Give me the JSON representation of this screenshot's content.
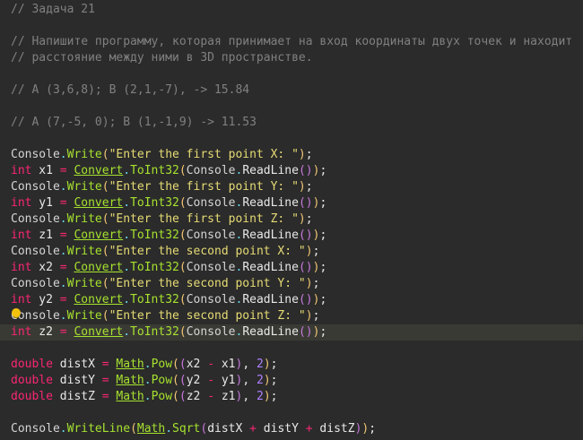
{
  "editor": {
    "current_line": 20,
    "lines": [
      [
        {
          "t": "// Задача 21",
          "k": "comment"
        }
      ],
      [],
      [
        {
          "t": "// Напишите программу, которая принимает на вход координаты двух точек и находит",
          "k": "comment"
        }
      ],
      [
        {
          "t": "// расстояние между ними в 3D пространстве.",
          "k": "comment"
        }
      ],
      [],
      [
        {
          "t": "// A (3,6,8); B (2,1,-7), -> 15.84",
          "k": "comment"
        }
      ],
      [],
      [
        {
          "t": "// A (7,-5, 0); B (1,-1,9) -> 11.53",
          "k": "comment"
        }
      ],
      [],
      [
        {
          "t": "Console",
          "k": "type"
        },
        {
          "t": ".",
          "k": "dot"
        },
        {
          "t": "Write",
          "k": "method"
        },
        {
          "t": "(",
          "k": "p1"
        },
        {
          "t": "\"Enter the first point X: \"",
          "k": "string"
        },
        {
          "t": ")",
          "k": "p1"
        },
        {
          "t": ";",
          "k": "punct"
        }
      ],
      [
        {
          "t": "int",
          "k": "keyword"
        },
        {
          "t": " x1 ",
          "k": "ident"
        },
        {
          "t": "=",
          "k": "op"
        },
        {
          "t": " ",
          "k": "ident"
        },
        {
          "t": "Convert",
          "k": "class"
        },
        {
          "t": ".",
          "k": "dot"
        },
        {
          "t": "ToInt32",
          "k": "method"
        },
        {
          "t": "(",
          "k": "p1"
        },
        {
          "t": "Console",
          "k": "type"
        },
        {
          "t": ".",
          "k": "dot"
        },
        {
          "t": "ReadLine",
          "k": "ident"
        },
        {
          "t": "(",
          "k": "p2"
        },
        {
          "t": ")",
          "k": "p2"
        },
        {
          "t": ")",
          "k": "p1"
        },
        {
          "t": ";",
          "k": "punct"
        }
      ],
      [
        {
          "t": "Console",
          "k": "type"
        },
        {
          "t": ".",
          "k": "dot"
        },
        {
          "t": "Write",
          "k": "method"
        },
        {
          "t": "(",
          "k": "p1"
        },
        {
          "t": "\"Enter the first point Y: \"",
          "k": "string"
        },
        {
          "t": ")",
          "k": "p1"
        },
        {
          "t": ";",
          "k": "punct"
        }
      ],
      [
        {
          "t": "int",
          "k": "keyword"
        },
        {
          "t": " y1 ",
          "k": "ident"
        },
        {
          "t": "=",
          "k": "op"
        },
        {
          "t": " ",
          "k": "ident"
        },
        {
          "t": "Convert",
          "k": "class"
        },
        {
          "t": ".",
          "k": "dot"
        },
        {
          "t": "ToInt32",
          "k": "method"
        },
        {
          "t": "(",
          "k": "p1"
        },
        {
          "t": "Console",
          "k": "type"
        },
        {
          "t": ".",
          "k": "dot"
        },
        {
          "t": "ReadLine",
          "k": "ident"
        },
        {
          "t": "(",
          "k": "p2"
        },
        {
          "t": ")",
          "k": "p2"
        },
        {
          "t": ")",
          "k": "p1"
        },
        {
          "t": ";",
          "k": "punct"
        }
      ],
      [
        {
          "t": "Console",
          "k": "type"
        },
        {
          "t": ".",
          "k": "dot"
        },
        {
          "t": "Write",
          "k": "method"
        },
        {
          "t": "(",
          "k": "p1"
        },
        {
          "t": "\"Enter the first point Z: \"",
          "k": "string"
        },
        {
          "t": ")",
          "k": "p1"
        },
        {
          "t": ";",
          "k": "punct"
        }
      ],
      [
        {
          "t": "int",
          "k": "keyword"
        },
        {
          "t": " z1 ",
          "k": "ident"
        },
        {
          "t": "=",
          "k": "op"
        },
        {
          "t": " ",
          "k": "ident"
        },
        {
          "t": "Convert",
          "k": "class"
        },
        {
          "t": ".",
          "k": "dot"
        },
        {
          "t": "ToInt32",
          "k": "method"
        },
        {
          "t": "(",
          "k": "p1"
        },
        {
          "t": "Console",
          "k": "type"
        },
        {
          "t": ".",
          "k": "dot"
        },
        {
          "t": "ReadLine",
          "k": "ident"
        },
        {
          "t": "(",
          "k": "p2"
        },
        {
          "t": ")",
          "k": "p2"
        },
        {
          "t": ")",
          "k": "p1"
        },
        {
          "t": ";",
          "k": "punct"
        }
      ],
      [
        {
          "t": "Console",
          "k": "type"
        },
        {
          "t": ".",
          "k": "dot"
        },
        {
          "t": "Write",
          "k": "method"
        },
        {
          "t": "(",
          "k": "p1"
        },
        {
          "t": "\"Enter the second point X: \"",
          "k": "string"
        },
        {
          "t": ")",
          "k": "p1"
        },
        {
          "t": ";",
          "k": "punct"
        }
      ],
      [
        {
          "t": "int",
          "k": "keyword"
        },
        {
          "t": " x2 ",
          "k": "ident"
        },
        {
          "t": "=",
          "k": "op"
        },
        {
          "t": " ",
          "k": "ident"
        },
        {
          "t": "Convert",
          "k": "class"
        },
        {
          "t": ".",
          "k": "dot"
        },
        {
          "t": "ToInt32",
          "k": "method"
        },
        {
          "t": "(",
          "k": "p1"
        },
        {
          "t": "Console",
          "k": "type"
        },
        {
          "t": ".",
          "k": "dot"
        },
        {
          "t": "ReadLine",
          "k": "ident"
        },
        {
          "t": "(",
          "k": "p2"
        },
        {
          "t": ")",
          "k": "p2"
        },
        {
          "t": ")",
          "k": "p1"
        },
        {
          "t": ";",
          "k": "punct"
        }
      ],
      [
        {
          "t": "Console",
          "k": "type"
        },
        {
          "t": ".",
          "k": "dot"
        },
        {
          "t": "Write",
          "k": "method"
        },
        {
          "t": "(",
          "k": "p1"
        },
        {
          "t": "\"Enter the second point Y: \"",
          "k": "string"
        },
        {
          "t": ")",
          "k": "p1"
        },
        {
          "t": ";",
          "k": "punct"
        }
      ],
      [
        {
          "t": "int",
          "k": "keyword"
        },
        {
          "t": " y2 ",
          "k": "ident"
        },
        {
          "t": "=",
          "k": "op"
        },
        {
          "t": " ",
          "k": "ident"
        },
        {
          "t": "Convert",
          "k": "class"
        },
        {
          "t": ".",
          "k": "dot"
        },
        {
          "t": "ToInt32",
          "k": "method"
        },
        {
          "t": "(",
          "k": "p1"
        },
        {
          "t": "Console",
          "k": "type"
        },
        {
          "t": ".",
          "k": "dot"
        },
        {
          "t": "ReadLine",
          "k": "ident"
        },
        {
          "t": "(",
          "k": "p2"
        },
        {
          "t": ")",
          "k": "p2"
        },
        {
          "t": ")",
          "k": "p1"
        },
        {
          "t": ";",
          "k": "punct"
        }
      ],
      [
        {
          "t": "Console",
          "k": "type"
        },
        {
          "t": ".",
          "k": "dot"
        },
        {
          "t": "Write",
          "k": "method"
        },
        {
          "t": "(",
          "k": "p1"
        },
        {
          "t": "\"Enter the second point Z: \"",
          "k": "string"
        },
        {
          "t": ")",
          "k": "p1"
        },
        {
          "t": ";",
          "k": "punct"
        }
      ],
      [
        {
          "t": "int",
          "k": "keyword"
        },
        {
          "t": " z2 ",
          "k": "ident"
        },
        {
          "t": "=",
          "k": "op"
        },
        {
          "t": " ",
          "k": "ident"
        },
        {
          "t": "Convert",
          "k": "class"
        },
        {
          "t": ".",
          "k": "dot"
        },
        {
          "t": "ToInt32",
          "k": "method"
        },
        {
          "t": "(",
          "k": "p1"
        },
        {
          "t": "Console",
          "k": "type"
        },
        {
          "t": ".",
          "k": "dot"
        },
        {
          "t": "ReadLine",
          "k": "ident"
        },
        {
          "t": "(",
          "k": "p2"
        },
        {
          "t": ")",
          "k": "p2"
        },
        {
          "t": ")",
          "k": "p1"
        },
        {
          "t": ";",
          "k": "punct"
        }
      ],
      [],
      [
        {
          "t": "double",
          "k": "keyword"
        },
        {
          "t": " distX ",
          "k": "ident"
        },
        {
          "t": "=",
          "k": "op"
        },
        {
          "t": " ",
          "k": "ident"
        },
        {
          "t": "Math",
          "k": "class"
        },
        {
          "t": ".",
          "k": "dot"
        },
        {
          "t": "Pow",
          "k": "method"
        },
        {
          "t": "(",
          "k": "p1"
        },
        {
          "t": "(",
          "k": "p2"
        },
        {
          "t": "x2 ",
          "k": "ident"
        },
        {
          "t": "-",
          "k": "op"
        },
        {
          "t": " x1",
          "k": "ident"
        },
        {
          "t": ")",
          "k": "p2"
        },
        {
          "t": ", ",
          "k": "punct"
        },
        {
          "t": "2",
          "k": "num"
        },
        {
          "t": ")",
          "k": "p1"
        },
        {
          "t": ";",
          "k": "punct"
        }
      ],
      [
        {
          "t": "double",
          "k": "keyword"
        },
        {
          "t": " distY ",
          "k": "ident"
        },
        {
          "t": "=",
          "k": "op"
        },
        {
          "t": " ",
          "k": "ident"
        },
        {
          "t": "Math",
          "k": "class"
        },
        {
          "t": ".",
          "k": "dot"
        },
        {
          "t": "Pow",
          "k": "method"
        },
        {
          "t": "(",
          "k": "p1"
        },
        {
          "t": "(",
          "k": "p2"
        },
        {
          "t": "y2 ",
          "k": "ident"
        },
        {
          "t": "-",
          "k": "op"
        },
        {
          "t": " y1",
          "k": "ident"
        },
        {
          "t": ")",
          "k": "p2"
        },
        {
          "t": ", ",
          "k": "punct"
        },
        {
          "t": "2",
          "k": "num"
        },
        {
          "t": ")",
          "k": "p1"
        },
        {
          "t": ";",
          "k": "punct"
        }
      ],
      [
        {
          "t": "double",
          "k": "keyword"
        },
        {
          "t": " distZ ",
          "k": "ident"
        },
        {
          "t": "=",
          "k": "op"
        },
        {
          "t": " ",
          "k": "ident"
        },
        {
          "t": "Math",
          "k": "class"
        },
        {
          "t": ".",
          "k": "dot"
        },
        {
          "t": "Pow",
          "k": "method"
        },
        {
          "t": "(",
          "k": "p1"
        },
        {
          "t": "(",
          "k": "p2"
        },
        {
          "t": "z2 ",
          "k": "ident"
        },
        {
          "t": "-",
          "k": "op"
        },
        {
          "t": " z1",
          "k": "ident"
        },
        {
          "t": ")",
          "k": "p2"
        },
        {
          "t": ", ",
          "k": "punct"
        },
        {
          "t": "2",
          "k": "num"
        },
        {
          "t": ")",
          "k": "p1"
        },
        {
          "t": ";",
          "k": "punct"
        }
      ],
      [],
      [
        {
          "t": "Console",
          "k": "type"
        },
        {
          "t": ".",
          "k": "dot"
        },
        {
          "t": "WriteLine",
          "k": "method"
        },
        {
          "t": "(",
          "k": "p1"
        },
        {
          "t": "Math",
          "k": "class"
        },
        {
          "t": ".",
          "k": "dot"
        },
        {
          "t": "Sqrt",
          "k": "method"
        },
        {
          "t": "(",
          "k": "p2"
        },
        {
          "t": "distX ",
          "k": "ident"
        },
        {
          "t": "+",
          "k": "op"
        },
        {
          "t": " distY ",
          "k": "ident"
        },
        {
          "t": "+",
          "k": "op"
        },
        {
          "t": " distZ",
          "k": "ident"
        },
        {
          "t": ")",
          "k": "p2"
        },
        {
          "t": ")",
          "k": "p1"
        },
        {
          "t": ";",
          "k": "punct"
        }
      ]
    ]
  },
  "gutter": {
    "lightbulb_icon": "lightbulb-icon",
    "lightbulb_color": "#f4c20d"
  }
}
